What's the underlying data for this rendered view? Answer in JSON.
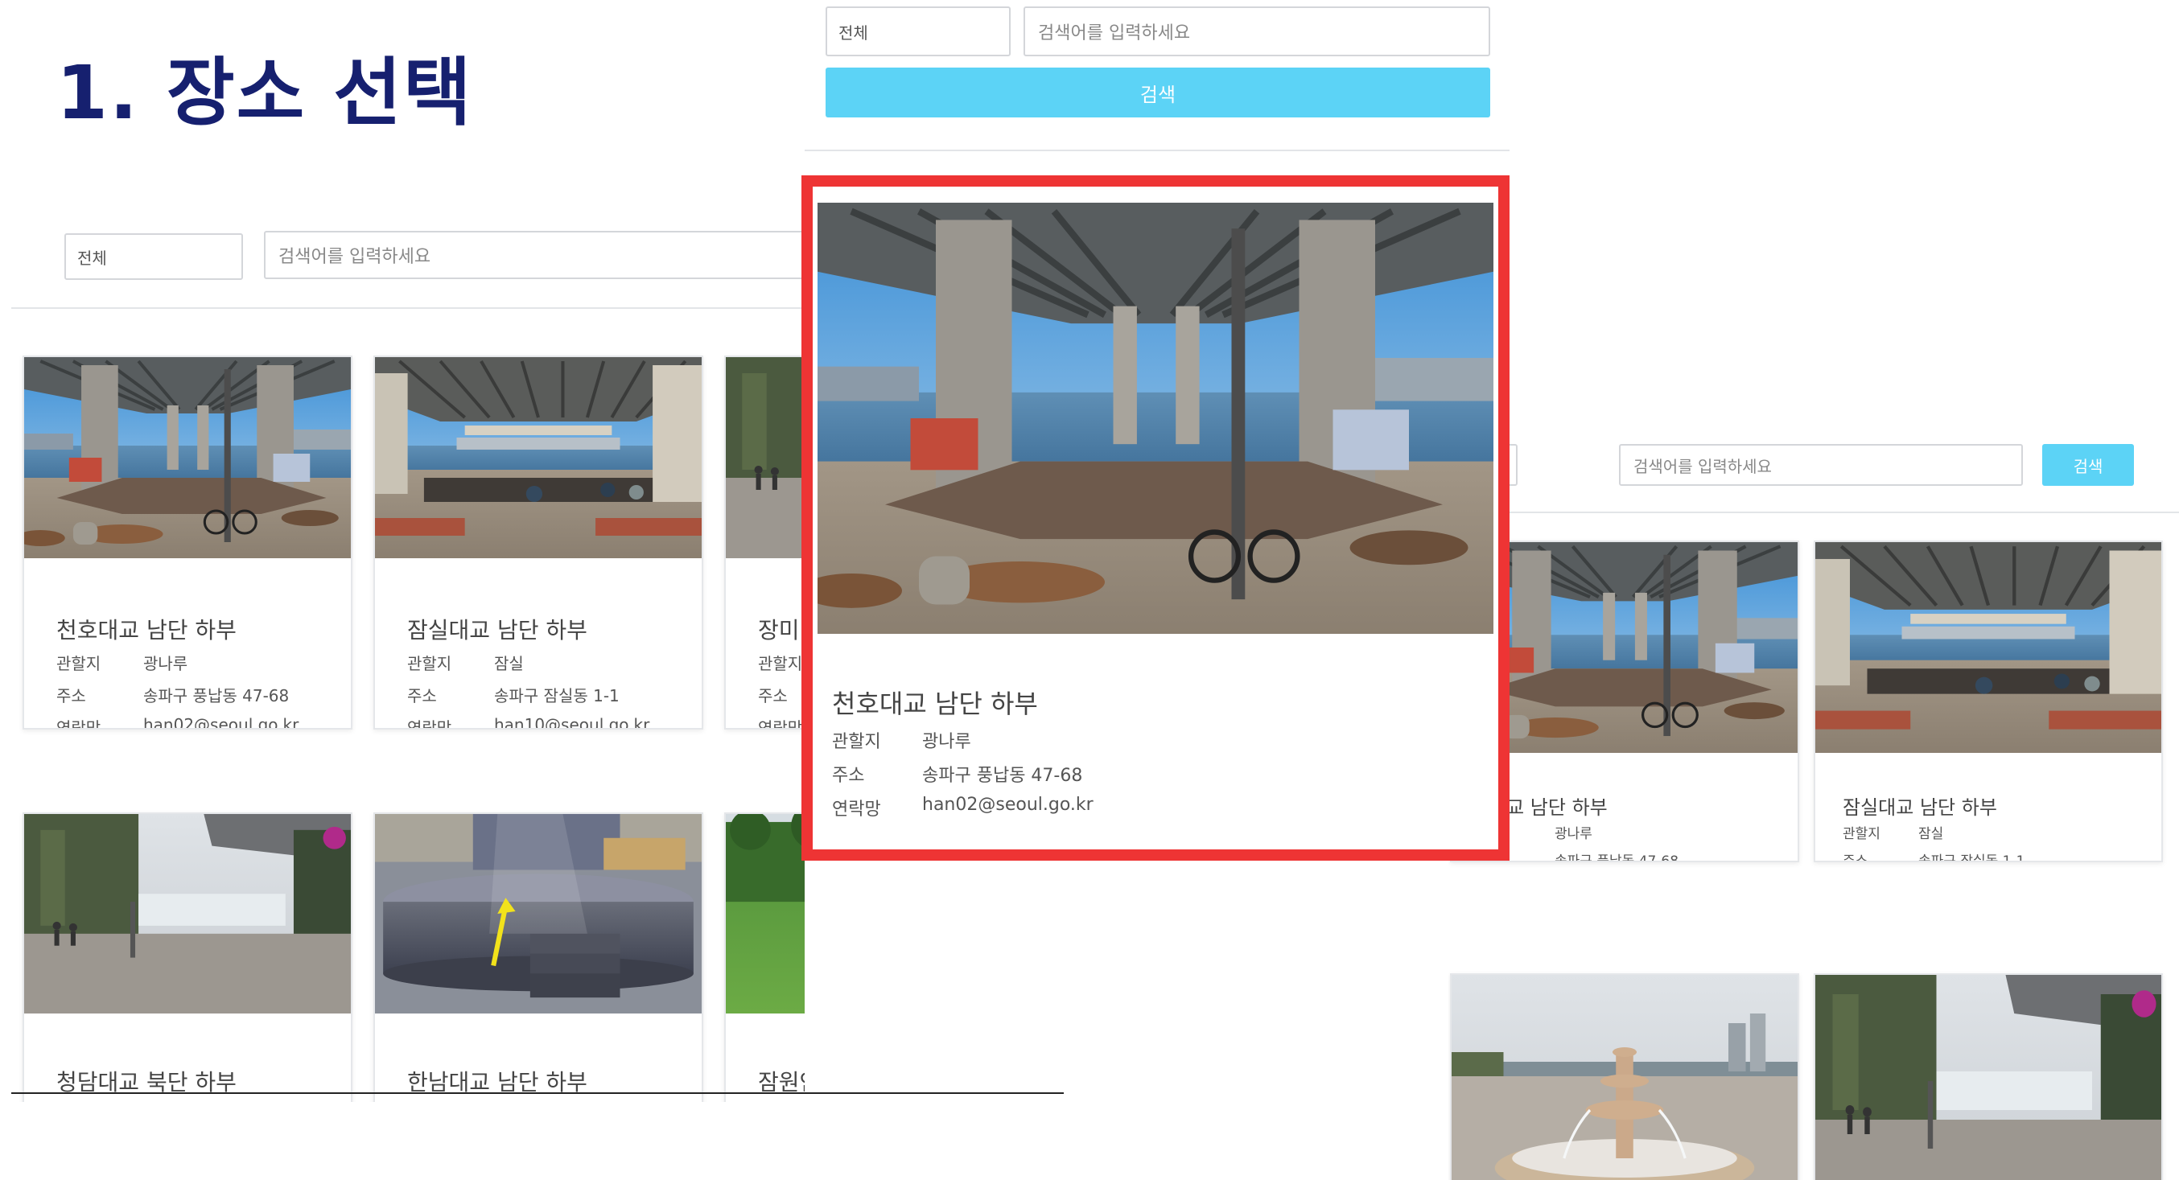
{
  "title": "1.  장소 선택",
  "search": {
    "category": "전체",
    "placeholder": "검색어를 입력하세요",
    "button_label": "검색"
  },
  "places": [
    {
      "name": "천호대교 남단 하부",
      "district_label": "관할지",
      "district": "광나루",
      "address_label": "주소",
      "address": "송파구 풍납동 47-68",
      "contact_label": "연락망",
      "contact": "han02@seoul.go.kr"
    },
    {
      "name": "잠실대교 남단 하부",
      "district_label": "관할지",
      "district": "잠실",
      "address_label": "주소",
      "address": "송파구 잠실동 1-1",
      "contact_label": "연락망",
      "contact": "han10@seoul.go.kr"
    },
    {
      "name": "장미",
      "district_label": "관할지",
      "address_label": "주소",
      "contact_label": "연락망"
    },
    {
      "name": "청담대교 북단 하부"
    },
    {
      "name": "한남대교 남단 하부"
    },
    {
      "name": "잠원안내센터 녹지대"
    }
  ],
  "right_view": {
    "card1_name": "대교 남단 하부"
  },
  "colors": {
    "title": "#16206f",
    "button": "#5cd3f6",
    "highlight_border": "#ee3434"
  },
  "icons": {
    "arrow": "yellow-arrow"
  }
}
